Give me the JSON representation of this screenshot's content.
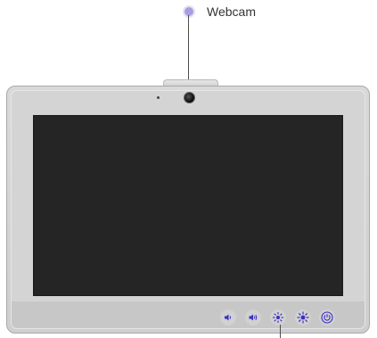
{
  "callout": {
    "label": "Webcam"
  },
  "colors": {
    "accent": "#3a2fc4",
    "callout_dot": "#a79fdd",
    "bezel": "#d4d4d4",
    "screen": "#252525"
  },
  "buttons": [
    {
      "icon": "volume-down-icon"
    },
    {
      "icon": "volume-up-icon"
    },
    {
      "icon": "brightness-down-icon"
    },
    {
      "icon": "brightness-up-icon"
    },
    {
      "icon": "power-icon"
    }
  ]
}
